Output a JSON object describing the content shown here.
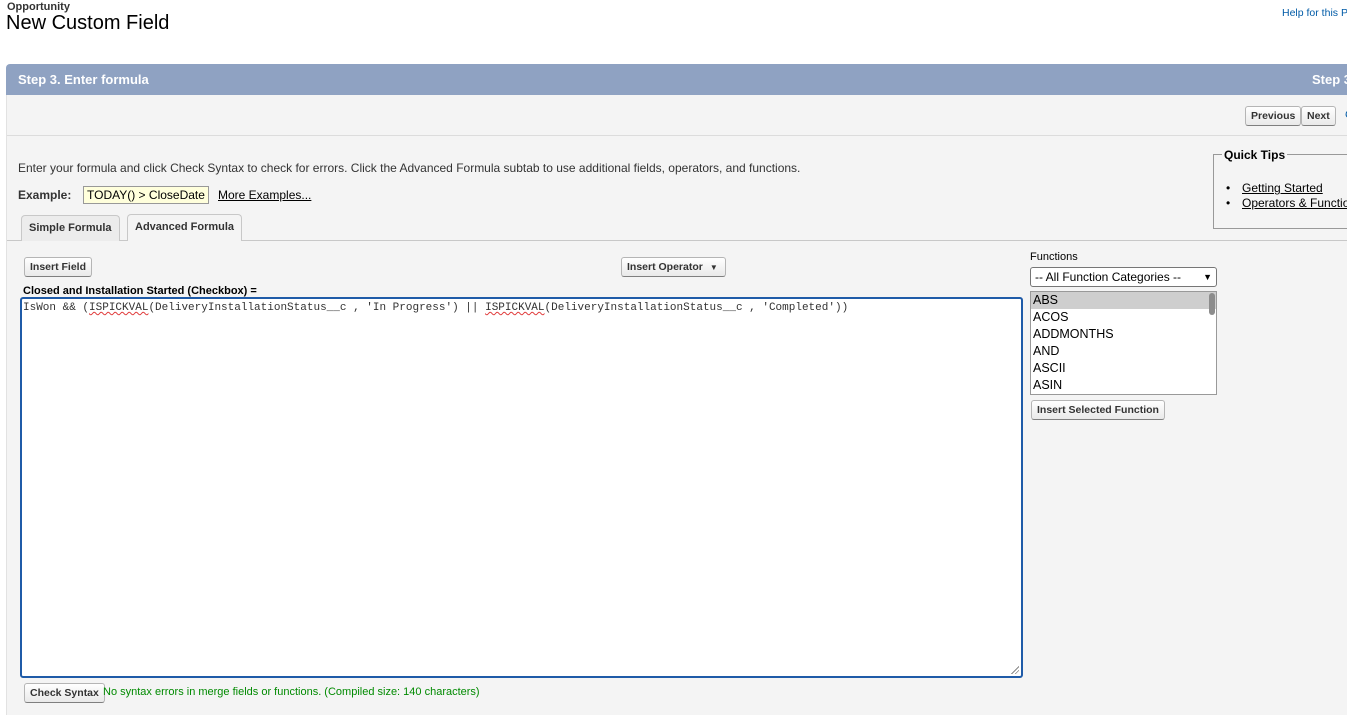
{
  "header": {
    "object_label": "Opportunity",
    "title": "New Custom Field",
    "help_link": "Help for this P"
  },
  "step": {
    "title": "Step 3. Enter formula",
    "right_label": "Step 3"
  },
  "nav": {
    "previous": "Previous",
    "next": "Next",
    "cancel": "C"
  },
  "intro": {
    "text": "Enter your formula and click Check Syntax to check for errors. Click the Advanced Formula subtab to use additional fields, operators, and functions.",
    "example_label": "Example:",
    "example_value": "TODAY() > CloseDate",
    "more_examples": "More Examples..."
  },
  "quick_tips": {
    "legend": "Quick Tips",
    "links": [
      "Getting Started",
      "Operators & Functions"
    ]
  },
  "tabs": [
    {
      "label": "Simple Formula",
      "active": false
    },
    {
      "label": "Advanced Formula",
      "active": true
    }
  ],
  "toolbar": {
    "insert_field": "Insert Field",
    "insert_operator": "Insert Operator"
  },
  "formula": {
    "field_label": "Closed and Installation Started (Checkbox) =",
    "code_parts": [
      "IsWon && (",
      "ISPICKVAL",
      "(DeliveryInstallationStatus__c , 'In Progress') || ",
      "ISPICKVAL",
      "(DeliveryInstallationStatus__c , 'Completed'))"
    ]
  },
  "check": {
    "button": "Check Syntax",
    "message": "No syntax errors in merge fields or functions. (Compiled size: 140 characters)"
  },
  "functions": {
    "label": "Functions",
    "category": "-- All Function Categories --",
    "items": [
      "ABS",
      "ACOS",
      "ADDMONTHS",
      "AND",
      "ASCII",
      "ASIN"
    ],
    "selected": "ABS",
    "insert_button": "Insert Selected Function"
  },
  "colors": {
    "step_bar": "#8fa2c2",
    "editor_border": "#1f5ba8",
    "success_text": "#008a00",
    "link": "#015ba7"
  }
}
